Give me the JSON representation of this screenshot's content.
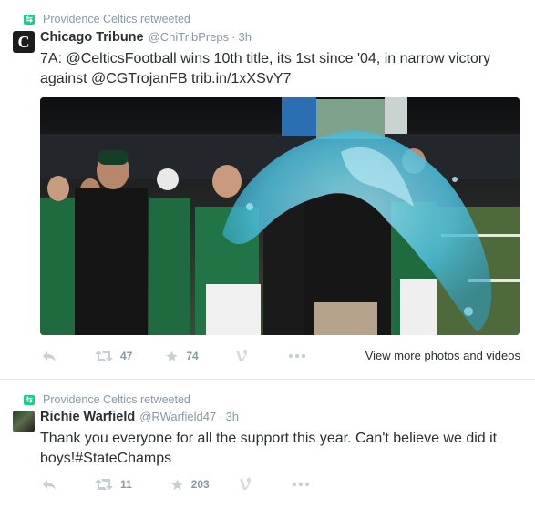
{
  "tweet1": {
    "retweeted_by": "Providence Celtics retweeted",
    "avatar_letter": "C",
    "name": "Chicago Tribune",
    "handle": "@ChiTribPreps",
    "separator": "·",
    "time": "3h",
    "text_parts": [
      "7A: ",
      "@CelticsFootball",
      " wins 10th title, its 1st since '04, in narrow victory against ",
      "@CGTrojanFB",
      " ",
      "trib.in/1xXSvY7"
    ],
    "retweets": "47",
    "favorites": "74",
    "more_media": "View more photos and videos"
  },
  "tweet2": {
    "retweeted_by": "Providence Celtics retweeted",
    "name": "Richie Warfield",
    "handle": "@RWarfield47",
    "separator": "·",
    "time": "3h",
    "text_parts": [
      "Thank you everyone for all the support this year. Can't believe we did it boys!",
      "#StateChamps"
    ],
    "retweets": "11",
    "favorites": "203"
  },
  "icons": {
    "retweet_badge": "retweet-icon",
    "reply": "reply-icon",
    "retweet": "retweet-icon",
    "favorite": "star-icon",
    "vine": "vine-icon",
    "more": "more-icon"
  },
  "colors": {
    "retweet_green": "#19cf86",
    "meta_grey": "#8899a6",
    "text": "#292f33",
    "water": "#5fc6e0",
    "jersey_green": "#1f6b3f"
  }
}
